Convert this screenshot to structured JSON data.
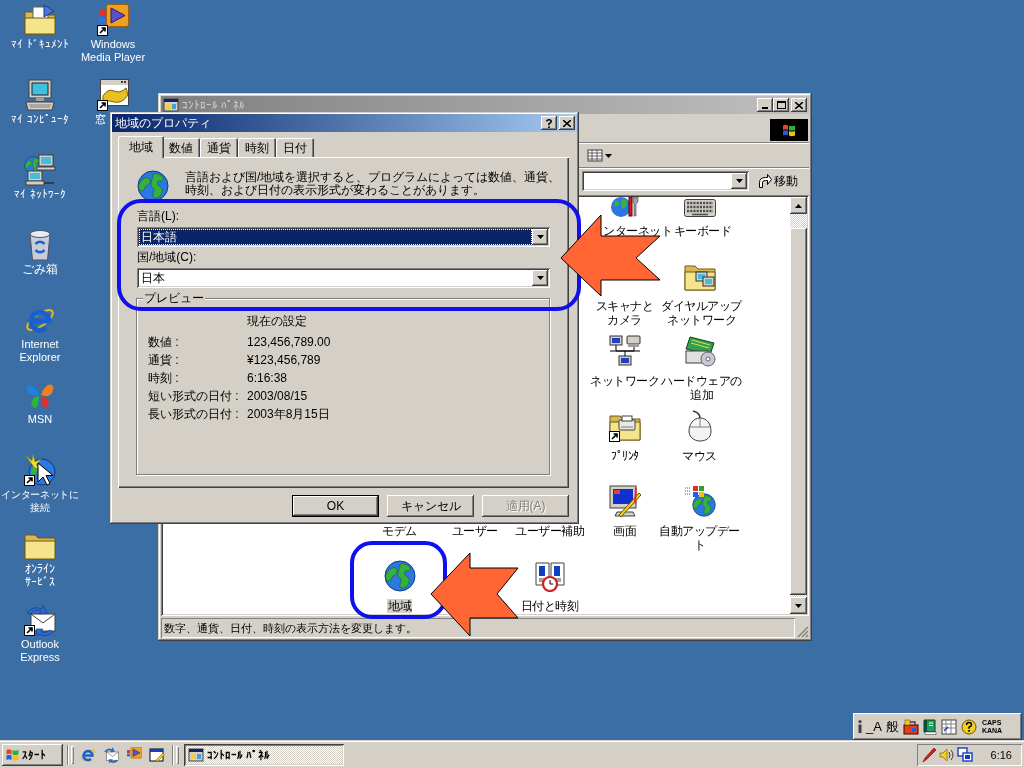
{
  "desktop": {
    "columns": [
      [
        "ﾏｲ ﾄﾞｷｭﾒﾝﾄ",
        "ﾏｲ ｺﾝﾋﾟｭｰﾀ",
        "ﾏｲ ﾈｯﾄﾜｰｸ",
        "ごみ箱",
        "Internet Explorer",
        "MSN",
        "インターネットに接続",
        "ｵﾝﾗｲﾝｻｰﾋﾞｽ",
        "Outlook Express"
      ],
      [
        "Windows Media Player",
        "窓"
      ]
    ]
  },
  "control_panel": {
    "title": "ｺﾝﾄﾛｰﾙ ﾊﾟﾈﾙ",
    "go_button": "移動",
    "items": [
      {
        "label": "ンターネット",
        "selected": false
      },
      {
        "label": "キーボード",
        "selected": false
      },
      {
        "label": "スキャナとカメラ",
        "selected": false
      },
      {
        "label": "ダイヤルアップネットワーク",
        "selected": false
      },
      {
        "label": "ネットワーク",
        "selected": false
      },
      {
        "label": "ハードウェアの追加",
        "selected": false
      },
      {
        "label": "ﾌﾟﾘﾝﾀ",
        "selected": false
      },
      {
        "label": "マウス",
        "selected": false
      },
      {
        "label": "モデム",
        "selected": false
      },
      {
        "label": "ユーザー",
        "selected": false
      },
      {
        "label": "ユーザー補助",
        "selected": false
      },
      {
        "label": "画面",
        "selected": false
      },
      {
        "label": "自動アップデート",
        "selected": false
      },
      {
        "label": "地域",
        "selected": true
      },
      {
        "label": "日付と時刻",
        "selected": false
      }
    ],
    "status_text": "数字、通貨、日付、時刻の表示方法を変更します。"
  },
  "dialog": {
    "title": "地域のプロパティ",
    "tabs": [
      {
        "label": "地域",
        "selected": true
      },
      {
        "label": "数値",
        "selected": false
      },
      {
        "label": "通貨",
        "selected": false
      },
      {
        "label": "時刻",
        "selected": false
      },
      {
        "label": "日付",
        "selected": false
      }
    ],
    "description": "言語および国/地域を選択すると、プログラムによっては数値、通貨、時刻、および日付の表示形式が変わることがあります。",
    "fields": [
      {
        "label": "言語(L):",
        "value": "日本語",
        "focused": true
      },
      {
        "label": "国/地域(C):",
        "value": "日本",
        "focused": false
      }
    ],
    "preview": {
      "title": "プレビュー",
      "heading": "現在の設定",
      "rows": [
        {
          "label": "数値 :",
          "value": "123,456,789.00"
        },
        {
          "label": "通貨 :",
          "value": "¥123,456,789"
        },
        {
          "label": "時刻 :",
          "value": "6:16:38"
        },
        {
          "label": "短い形式の日付 :",
          "value": "2003/08/15"
        },
        {
          "label": "長い形式の日付 :",
          "value": "2003年8月15日"
        }
      ]
    },
    "buttons": [
      {
        "label": "OK",
        "default": true,
        "disabled": false
      },
      {
        "label": "キャンセル",
        "default": false,
        "disabled": false
      },
      {
        "label": "適用(A)",
        "default": false,
        "disabled": true
      }
    ]
  },
  "language_bar": {
    "input_mode": "_A",
    "conversion_mode": "般",
    "indicators": [
      "CAPS",
      "KANA"
    ]
  },
  "taskbar": {
    "start_button": "ｽﾀｰﾄ",
    "tasks": [
      {
        "label": "ｺﾝﾄﾛｰﾙ ﾊﾟﾈﾙ",
        "selected": true
      }
    ],
    "clock": "6:16"
  }
}
